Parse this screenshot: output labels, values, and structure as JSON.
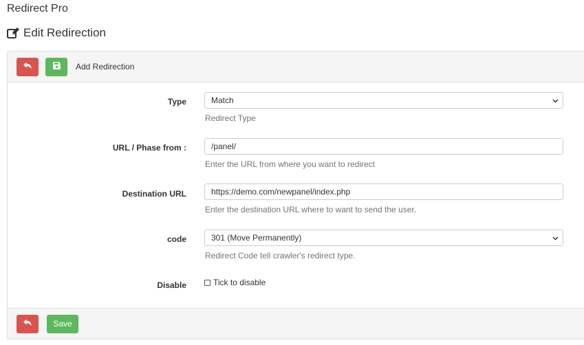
{
  "app": {
    "title": "Redirect Pro"
  },
  "page": {
    "heading": "Edit Redirection"
  },
  "header": {
    "label": "Add Redirection"
  },
  "form": {
    "type": {
      "label": "Type",
      "value": "Match",
      "help": "Redirect Type"
    },
    "url_from": {
      "label": "URL / Phase from :",
      "value": "/panel/",
      "help": "Enter the URL from where you want to redirect"
    },
    "destination": {
      "label": "Destination URL",
      "value": "https://demo.com/newpanel/index.php",
      "help": "Enter the destination URL where to want to send the user."
    },
    "code": {
      "label": "code",
      "value": "301 (Move Permanently)",
      "help": "Redirect Code tell crawler's redirect type."
    },
    "disable": {
      "label": "Disable",
      "checkbox_label": "Tick to disable",
      "checked": false
    }
  },
  "footer": {
    "save_label": "Save"
  },
  "icons": [
    "back-arrow-icon",
    "floppy-disk-icon",
    "edit-icon",
    "chevron-down-icon"
  ],
  "colors": {
    "danger": "#d9534f",
    "success": "#5cb85c",
    "panel_bg": "#f5f5f5"
  }
}
